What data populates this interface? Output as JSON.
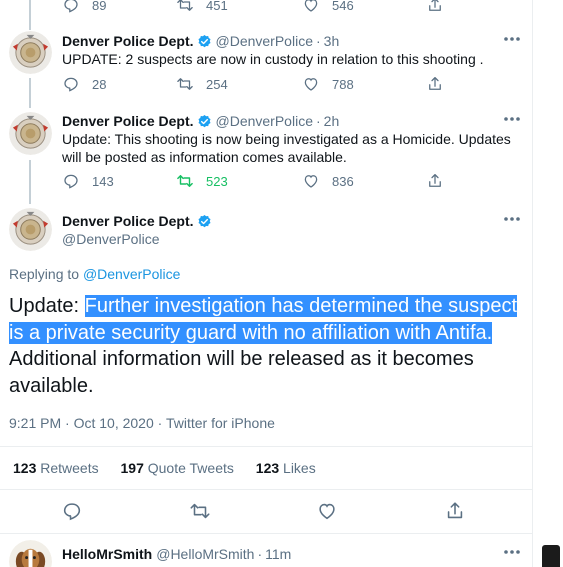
{
  "top_actions": {
    "reply_count": "89",
    "retweet_count": "451",
    "like_count": "546"
  },
  "tweets": [
    {
      "name": "Denver Police Dept.",
      "handle": "@DenverPolice",
      "time": "3h",
      "text": "UPDATE: 2 suspects are now in custody in relation to this shooting .",
      "reply_count": "28",
      "retweet_count": "254",
      "like_count": "788"
    },
    {
      "name": "Denver Police Dept.",
      "handle": "@DenverPolice",
      "time": "2h",
      "text": "Update: This shooting is now being investigated as a Homicide. Updates will be posted as information comes available.",
      "reply_count": "143",
      "retweet_count": "523",
      "like_count": "836"
    }
  ],
  "main_tweet": {
    "name": "Denver Police Dept.",
    "handle": "@DenverPolice",
    "replying_prefix": "Replying to",
    "replying_to": "@DenverPolice",
    "text_before": "Update: ",
    "text_highlighted": "Further investigation has determined the suspect is a private security guard with no affiliation with Antifa.",
    "text_after": " Additional information will be released as it becomes available.",
    "timestamp": "9:21 PM · Oct 10, 2020",
    "source_sep": " · ",
    "source": "Twitter for iPhone",
    "retweets_count": "123",
    "retweets_label": "Retweets",
    "quotes_count": "197",
    "quotes_label": "Quote Tweets",
    "likes_count": "123",
    "likes_label": "Likes"
  },
  "reply_preview": {
    "name": "HelloMrSmith",
    "handle": "@HelloMrSmith",
    "time": "11m"
  },
  "colors": {
    "accent": "#1b95e0",
    "retweet_active": "#17bf63",
    "text_secondary": "#5b7083",
    "selection": "#3390ff"
  }
}
